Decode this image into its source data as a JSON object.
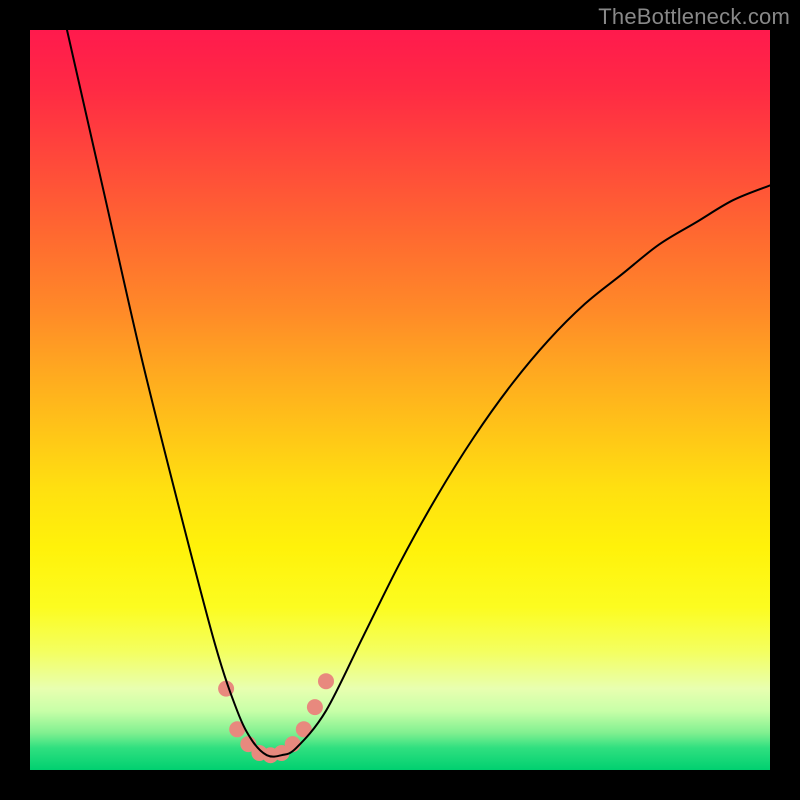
{
  "watermark": "TheBottleneck.com",
  "chart_data": {
    "type": "line",
    "title": "",
    "xlabel": "",
    "ylabel": "",
    "xlim": [
      0,
      100
    ],
    "ylim": [
      0,
      100
    ],
    "grid": false,
    "legend": false,
    "annotations": [],
    "series": [
      {
        "name": "curve",
        "color": "#000000",
        "x": [
          5,
          10,
          15,
          20,
          25,
          28,
          30,
          32,
          34,
          36,
          40,
          45,
          50,
          55,
          60,
          65,
          70,
          75,
          80,
          85,
          90,
          95,
          100
        ],
        "y": [
          100,
          78,
          56,
          36,
          17,
          8,
          4,
          2,
          2,
          3,
          8,
          18,
          28,
          37,
          45,
          52,
          58,
          63,
          67,
          71,
          74,
          77,
          79
        ]
      }
    ],
    "markers": {
      "name": "highlight-dots",
      "color": "#e8897e",
      "radius": 8,
      "points": [
        {
          "x": 26.5,
          "y": 11
        },
        {
          "x": 28.0,
          "y": 5.5
        },
        {
          "x": 29.5,
          "y": 3.5
        },
        {
          "x": 31.0,
          "y": 2.3
        },
        {
          "x": 32.5,
          "y": 2.0
        },
        {
          "x": 34.0,
          "y": 2.3
        },
        {
          "x": 35.5,
          "y": 3.5
        },
        {
          "x": 37.0,
          "y": 5.5
        },
        {
          "x": 38.5,
          "y": 8.5
        },
        {
          "x": 40.0,
          "y": 12
        }
      ]
    }
  }
}
